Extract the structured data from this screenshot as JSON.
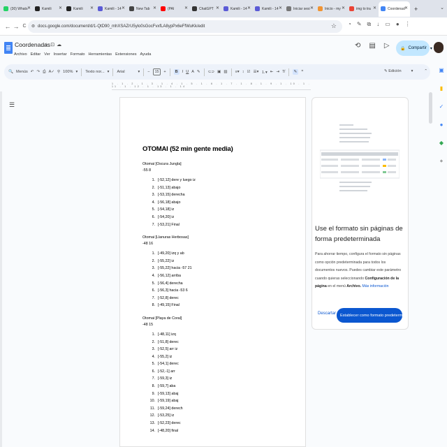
{
  "tabs": [
    {
      "title": "(30) Whats",
      "color": "#25d366"
    },
    {
      "title": "Kamili",
      "color": "#222222"
    },
    {
      "title": "Kamili",
      "color": "#222222"
    },
    {
      "title": "Kamili - 14",
      "color": "#5b5bd6"
    },
    {
      "title": "New Tab",
      "color": "#444444"
    },
    {
      "title": "(PAI",
      "color": "#ff0000"
    },
    {
      "title": "ChatGPT",
      "color": "#333333"
    },
    {
      "title": "Kamili - 14",
      "color": "#5b5bd6"
    },
    {
      "title": "Kamili - 14",
      "color": "#5b5bd6"
    },
    {
      "title": "Iniciar sesi",
      "color": "#777777"
    },
    {
      "title": "Inicio - my",
      "color": "#f09433"
    },
    {
      "title": "img to tra",
      "color": "#ea4335"
    },
    {
      "title": "Coordenad",
      "color": "#4285f4",
      "active": true
    }
  ],
  "browser": {
    "url": "docs.google.com/document/d/1-QtD90_mhXSAZrU5ylo0sGocFvxfLA8ypPx6eFfWuKk/edit",
    "new_tab": "+",
    "back": "←",
    "forward": "→",
    "reload": "C"
  },
  "doc": {
    "title": "Coordenadas",
    "menu": [
      "Archivo",
      "Editar",
      "Ver",
      "Insertar",
      "Formato",
      "Herramientas",
      "Extensiones",
      "Ayuda"
    ],
    "share_label": "Compartir"
  },
  "toolbar": {
    "search": "Menús",
    "zoom": "100%",
    "style": "Texto nor...",
    "font": "Arial",
    "size": "15",
    "mode": "Edición"
  },
  "ruler_text": "1 . 1 . 2 . 1 . 3 . 1 . 4 . 1 . 5 . 1 . 6 . 1 . 7 . 1 . 8 . 1 . 9 . 1 . 10 . 1 . 11 . 1 . 12 . 1 . 13 . 1 . 14",
  "content": {
    "heading": "OTOMAI (52 min gente media)",
    "sections": [
      {
        "title": "Otomai [Oscura Jungla]",
        "sub": "-55 8",
        "items": [
          "[-52,12] dere y luego iz",
          "[-51,13] abajo",
          "[-53,15] derecha",
          "[-56,18] abajo",
          "[-54,18] iz",
          "[-54,20] iz",
          "[-53,21] Final"
        ]
      },
      {
        "title": "Otomai [Llanuras Herbosas]",
        "sub": "-48 16",
        "items": [
          "[-49,20] izq y ab",
          "[-55,22] iz",
          "[-55,22] hacia -57 21",
          "[-56,12] arriba",
          "[-56,4] derecha",
          "[-56,3] hacia -53 6",
          "[-52,8] derec",
          "[-49,15] Final"
        ]
      },
      {
        "title": "Otomai [Playa de Coral]",
        "sub": "-48 15",
        "items": [
          "[-48,11] izq",
          "[-51,8] derec",
          "[-52,5] arr iz",
          "[-55,2] iz",
          "[-54,1] derec",
          "[-52,-1] arr",
          "[-59,3] iz",
          "[-59,7] aba",
          "[-59,13] abaj",
          "[-59,19] abaj",
          "[-59,24] derech",
          "[-53,25] iz",
          "[-52,23] derec",
          "[-48,20] final"
        ]
      }
    ]
  },
  "panel": {
    "title": "Use el formato sin páginas de forma predeterminada",
    "body_1": "Para ahorrar tiempo, configura el formato sin páginas como opción predeterminada para todos los documentos nuevos. Puedes cambiar este parámetro cuando quieras seleccionando",
    "body_bold": "Configuración de la página",
    "body_2": "en el menú",
    "body_bold2": "Archivo.",
    "link": "Más información",
    "dismiss": "Descartar",
    "confirm": "Establecer como formato predeterminado"
  }
}
